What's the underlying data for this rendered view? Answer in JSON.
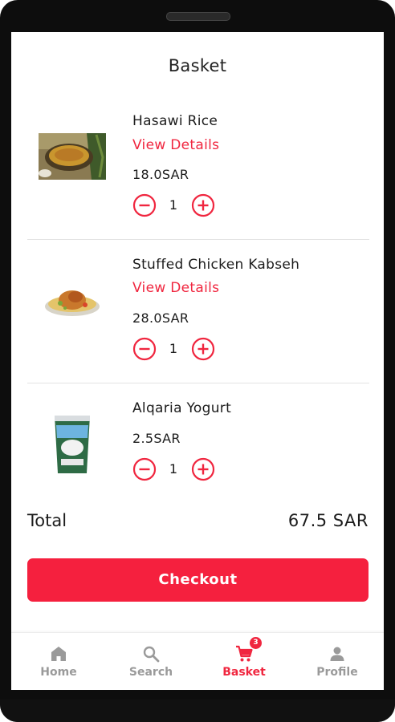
{
  "header": {
    "title": "Basket"
  },
  "items": [
    {
      "name": "Hasawi Rice",
      "details_label": "View Details",
      "price": "18.0SAR",
      "quantity": "1",
      "image": "hasawi-rice-dish"
    },
    {
      "name": "Stuffed Chicken Kabseh",
      "details_label": "View Details",
      "price": "28.0SAR",
      "quantity": "1",
      "image": "chicken-kabseh-plate"
    },
    {
      "name": "Alqaria Yogurt",
      "price": "2.5SAR",
      "quantity": "1",
      "image": "yogurt-cup"
    }
  ],
  "summary": {
    "total_label": "Total",
    "total_value": "67.5 SAR"
  },
  "checkout": {
    "label": "Checkout"
  },
  "nav": {
    "items": [
      {
        "label": "Home",
        "icon": "home-icon",
        "active": false
      },
      {
        "label": "Search",
        "icon": "search-icon",
        "active": false
      },
      {
        "label": "Basket",
        "icon": "cart-icon",
        "active": true,
        "badge": "3"
      },
      {
        "label": "Profile",
        "icon": "person-icon",
        "active": false
      }
    ]
  },
  "colors": {
    "accent": "#f0263f",
    "checkout_bg": "#f5203e",
    "inactive_nav": "#9a9a9a",
    "text": "#1c1c1c"
  }
}
